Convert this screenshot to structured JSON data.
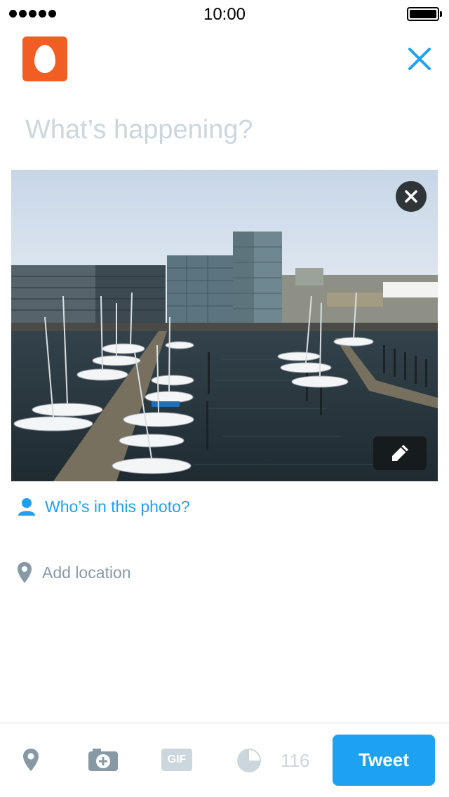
{
  "status_bar": {
    "time": "10:00",
    "signal_dots": 5,
    "battery_level": 1.0
  },
  "compose": {
    "placeholder": "What’s happening?",
    "avatar_icon": "egg-avatar-icon",
    "close_icon": "close-icon"
  },
  "photo": {
    "remove_icon": "close-circle-icon",
    "edit_icon": "pencil-icon",
    "tag_label": "Who’s in this photo?",
    "tag_icon": "person-icon"
  },
  "location": {
    "label": "Add location",
    "icon": "location-pin-icon"
  },
  "toolbar": {
    "icons": [
      "location-pin-icon",
      "camera-icon",
      "gif-icon",
      "character-counter-icon"
    ],
    "gif_label": "GIF",
    "count": "116",
    "tweet_label": "Tweet"
  },
  "colors": {
    "accent": "#1da1f2",
    "avatar": "#f05e23",
    "placeholder": "#ccd6dd",
    "secondary_text": "#8899a6",
    "toolbar_icon": "#8899a6"
  }
}
